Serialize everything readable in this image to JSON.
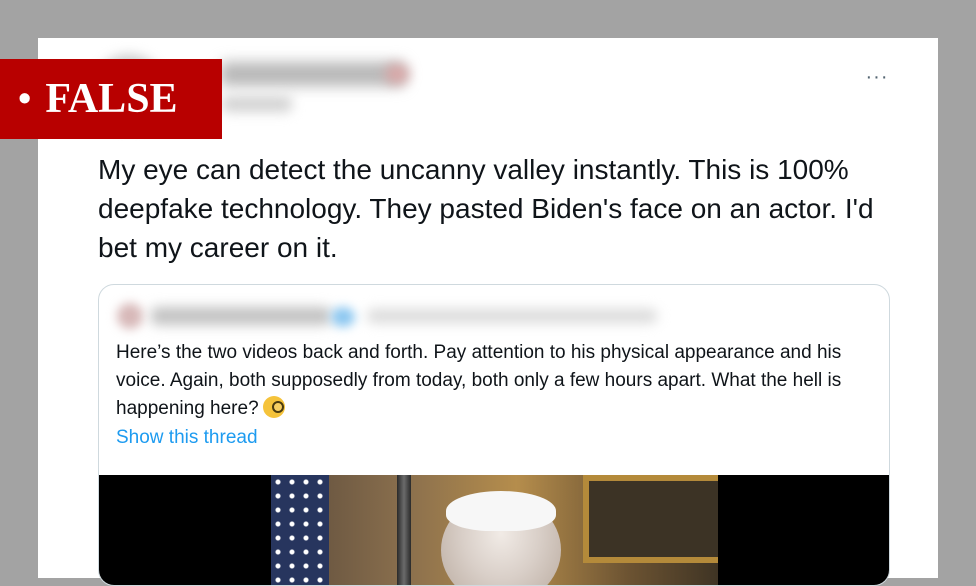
{
  "badge": {
    "label": "FALSE",
    "bullet": "•"
  },
  "tweet": {
    "text": "My eye can detect the uncanny valley instantly. This is 100% deepfake technology. They pasted Biden's face on an actor. I'd bet my career on it.",
    "more_icon": "···"
  },
  "quoted": {
    "text": "Here’s the two videos back and forth.  Pay attention to his physical appearance and his voice. Again, both supposedly from today,  both only a few hours apart. What the hell is happening here?",
    "emoji": "face-with-monocle-icon",
    "show_thread": "Show this thread"
  },
  "colors": {
    "badge_bg": "#b80000",
    "link": "#1d9bf0",
    "text": "#0f1419",
    "page_bg": "#a3a3a3"
  }
}
